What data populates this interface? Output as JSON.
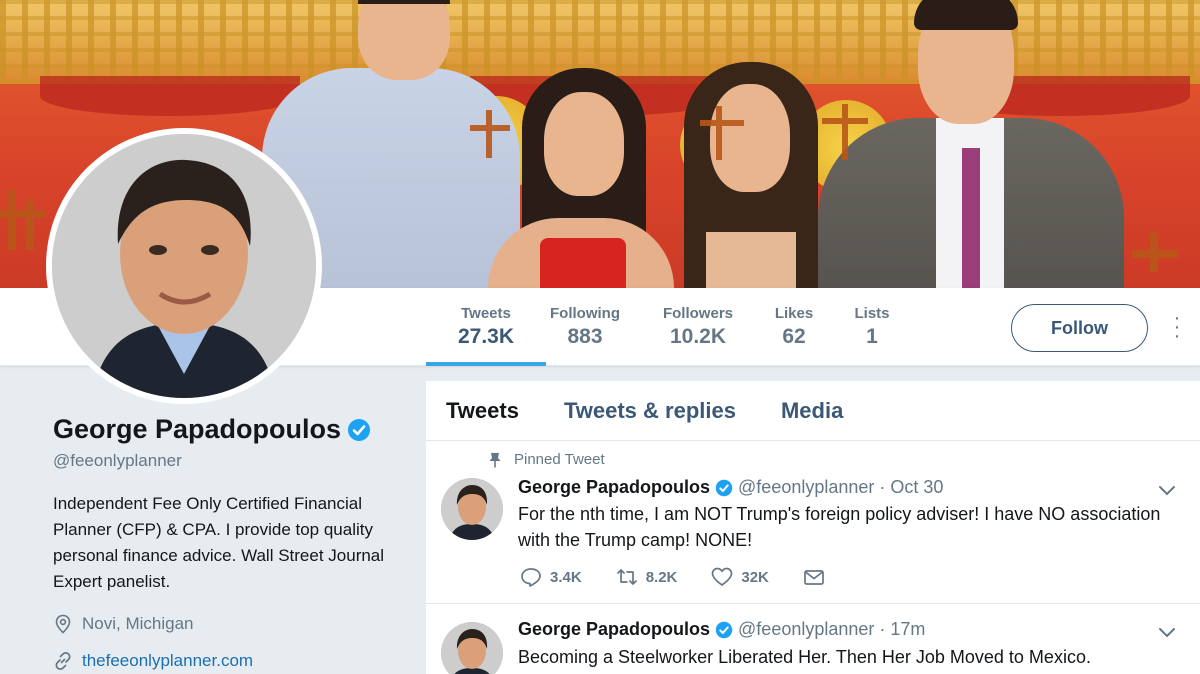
{
  "profile": {
    "name": "George Papadopoulos",
    "handle": "@feeonlyplanner",
    "bio": "Independent Fee Only Certified Financial Planner (CFP) & CPA. I provide top quality personal finance advice. Wall Street Journal Expert panelist.",
    "location": "Novi, Michigan",
    "website": "thefeeonlyplanner.com"
  },
  "stats": [
    {
      "label": "Tweets",
      "value": "27.3K"
    },
    {
      "label": "Following",
      "value": "883"
    },
    {
      "label": "Followers",
      "value": "10.2K"
    },
    {
      "label": "Likes",
      "value": "62"
    },
    {
      "label": "Lists",
      "value": "1"
    }
  ],
  "follow_label": "Follow",
  "tabs": [
    "Tweets",
    "Tweets & replies",
    "Media"
  ],
  "tweets": [
    {
      "pinned_label": "Pinned Tweet",
      "name": "George Papadopoulos",
      "handle": "@feeonlyplanner",
      "time": "· Oct 30",
      "text": "For the nth time, I am NOT Trump's foreign policy adviser! I have NO association with the Trump camp! NONE!",
      "replies": "3.4K",
      "retweets": "8.2K",
      "likes": "32K"
    },
    {
      "name": "George Papadopoulos",
      "handle": "@feeonlyplanner",
      "time": "· 17m",
      "text": "Becoming a Steelworker Liberated Her. Then Her Job Moved to Mexico."
    }
  ],
  "colors": {
    "accent": "#1b95e0",
    "navy": "#3b5876",
    "muted": "#657786",
    "verified": "#1da1f2",
    "background": "#e6ecf0"
  },
  "icons": [
    "verified-badge-icon",
    "location-pin-icon",
    "link-icon",
    "pin-icon",
    "chevron-down-icon",
    "reply-icon",
    "retweet-icon",
    "heart-icon",
    "direct-message-icon",
    "more-vertical-icon"
  ]
}
